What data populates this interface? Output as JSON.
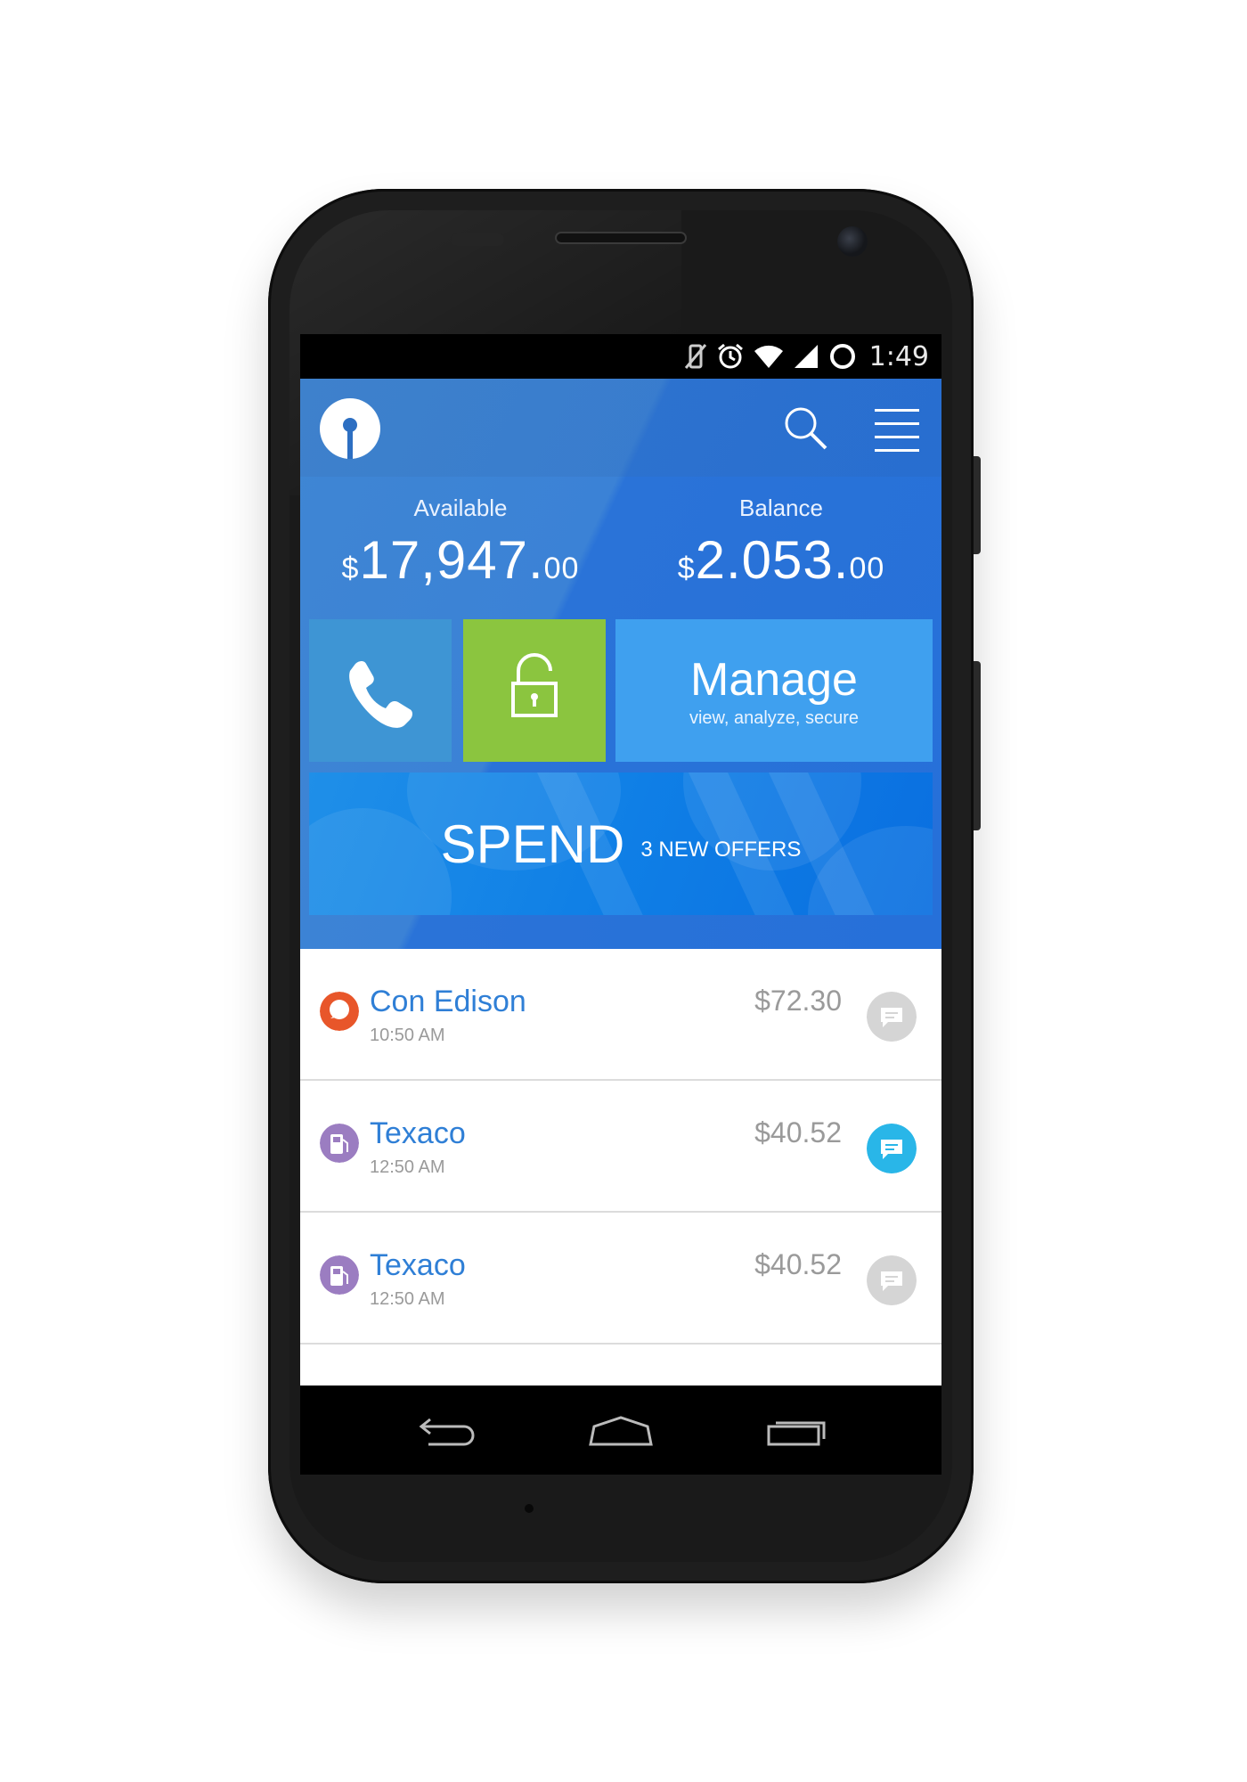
{
  "status_bar": {
    "time": "1:49"
  },
  "balances": {
    "available": {
      "label": "Available",
      "currency": "$",
      "whole": "17,947.",
      "cents": "00"
    },
    "balance": {
      "label": "Balance",
      "currency": "$",
      "whole": "2.053.",
      "cents": "00"
    }
  },
  "tiles": {
    "manage_title": "Manage",
    "manage_subtitle": "view, analyze, secure"
  },
  "spend": {
    "title": "SPEND",
    "offers": "3 NEW OFFERS"
  },
  "transactions": [
    {
      "name": "Con Edison",
      "time": "10:50 AM",
      "amount": "$72.30",
      "icon": "bulb-icon",
      "icon_color": "#e8562a",
      "chat_active": false
    },
    {
      "name": "Texaco",
      "time": "12:50 AM",
      "amount": "$40.52",
      "icon": "gas-pump-icon",
      "icon_color": "#9b7dc1",
      "chat_active": true
    },
    {
      "name": "Texaco",
      "time": "12:50 AM",
      "amount": "$40.52",
      "icon": "gas-pump-icon",
      "icon_color": "#9b7dc1",
      "chat_active": false
    }
  ],
  "colors": {
    "primary_blue": "#2f7fd6",
    "lock_green": "#8bc53f",
    "chat_active": "#29b6e8",
    "chat_inactive": "#d5d5d5"
  }
}
